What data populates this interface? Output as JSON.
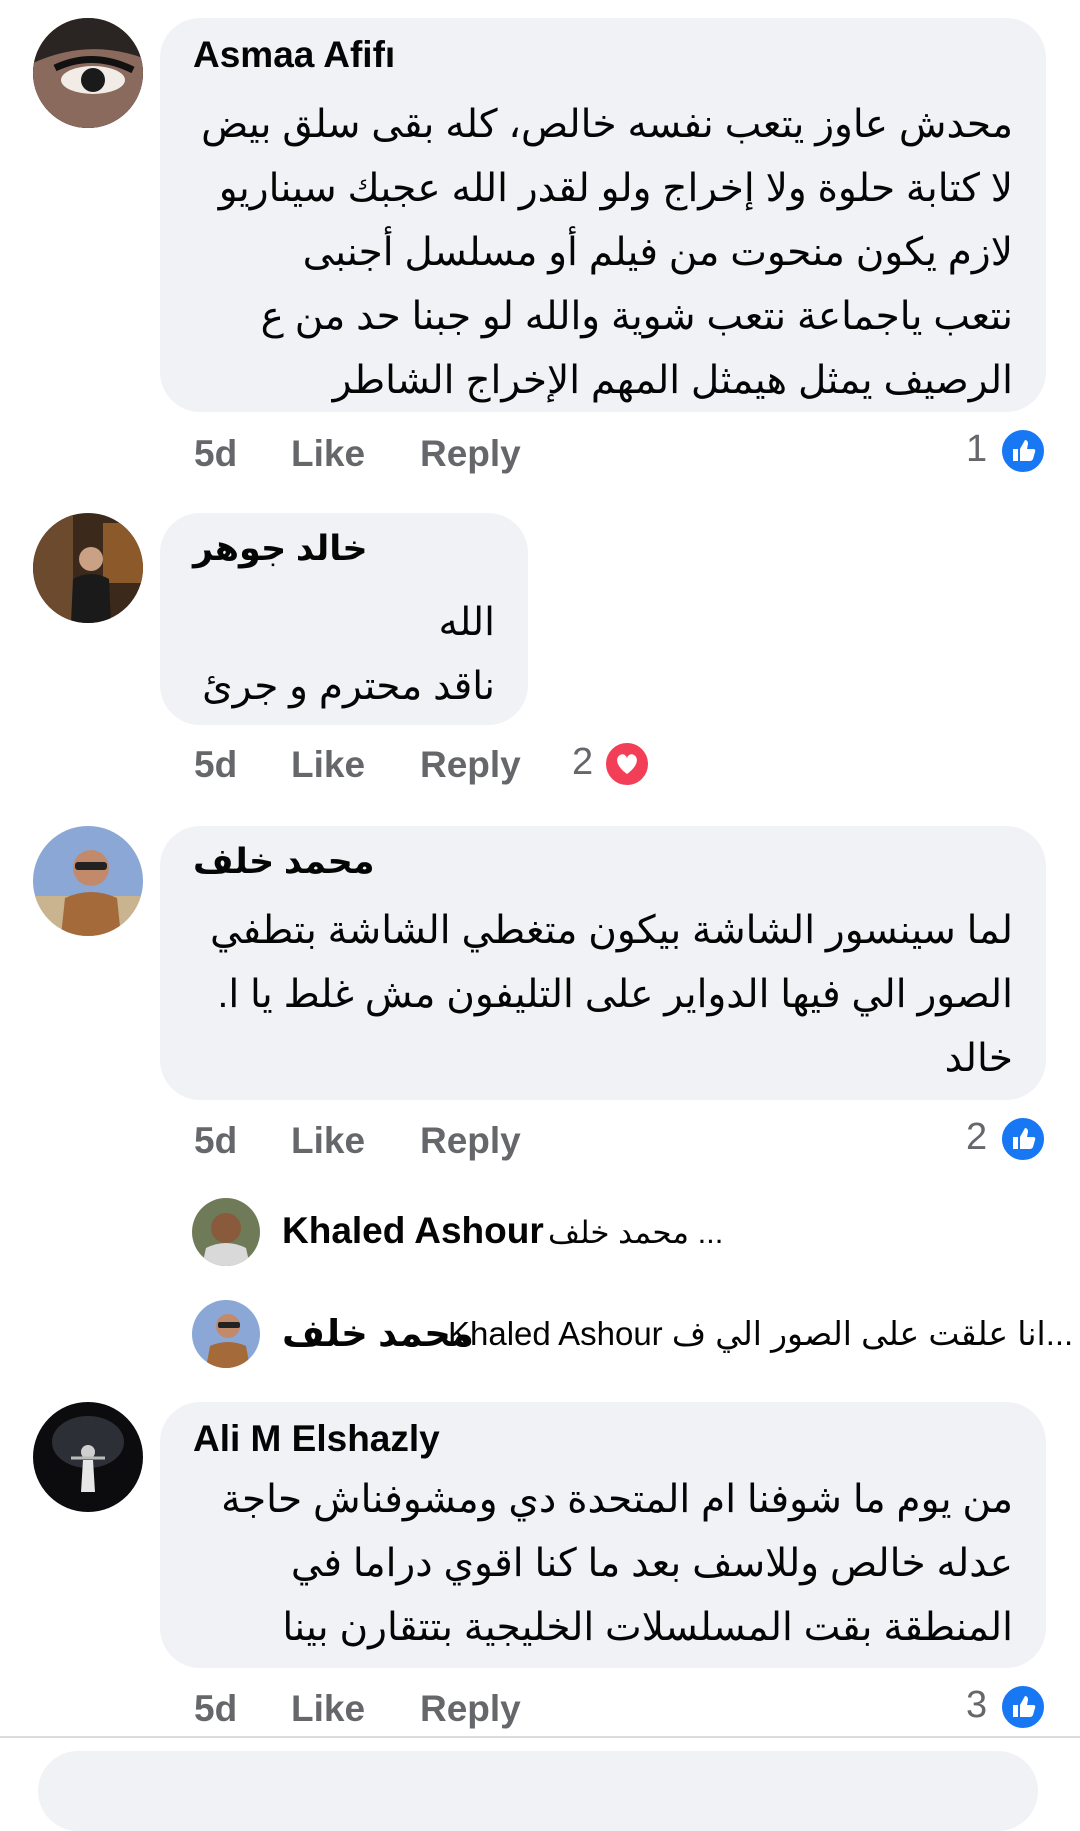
{
  "comments": [
    {
      "author": "Asmaa Afifı",
      "lines": [
        "محدش عاوز يتعب نفسه خالص، كله بقى سلق بيض",
        "لا كتابة حلوة ولا إخراج ولو لقدر الله عجبك سيناريو",
        "لازم يكون منحوت من فيلم أو مسلسل أجنبى",
        "نتعب ياجماعة نتعب شوية والله لو جبنا حد من ع",
        "الرصيف يمثل هيمثل المهم الإخراج الشاطر"
      ],
      "time": "5d",
      "like_label": "Like",
      "reply_label": "Reply",
      "reaction_count": "1",
      "reaction_icon": "like-icon"
    },
    {
      "author": "خالد جوهر",
      "lines": [
        "الله",
        "ناقد محترم و جرئ"
      ],
      "time": "5d",
      "like_label": "Like",
      "reply_label": "Reply",
      "reaction_count": "2",
      "reaction_icon": "love-icon"
    },
    {
      "author": "محمد خلف",
      "lines": [
        "لما سينسور الشاشة بيكون متغطي الشاشة بتطفي",
        "الصور الي فيها الدواير على التليفون مش غلط يا ا.",
        "خالد"
      ],
      "time": "5d",
      "like_label": "Like",
      "reply_label": "Reply",
      "reaction_count": "2",
      "reaction_icon": "like-icon"
    },
    {
      "author": "Ali M Elshazly",
      "lines": [
        "من يوم ما شوفنا ام المتحدة دي ومشوفناش حاجة",
        "عدله خالص وللاسف بعد ما كنا اقوي دراما في",
        "المنطقة بقت المسلسلات الخليجية بتتقارن بينا"
      ],
      "time": "5d",
      "like_label": "Like",
      "reply_label": "Reply",
      "reaction_count": "3",
      "reaction_icon": "like-icon"
    }
  ],
  "replies": [
    {
      "author": "Khaled Ashour",
      "preview": "محمد خلف ..."
    },
    {
      "author": "محمد خلف",
      "preview": "Khaled Ashour انا علقت على الصور الي ف..."
    }
  ],
  "colors": {
    "bubble": "#f0f2f5",
    "meta": "#65676b",
    "like_blue": "#1877f2",
    "love_red": "#f33e58"
  }
}
